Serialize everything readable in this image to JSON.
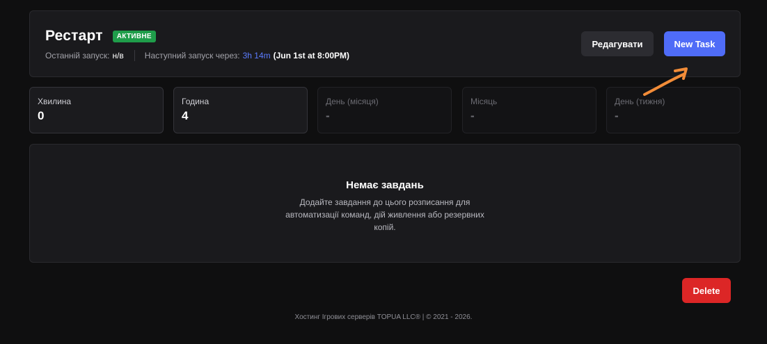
{
  "schedule": {
    "title": "Рестарт",
    "status_badge": "АКТИВНЕ",
    "last_run_label": "Останній запуск:",
    "last_run_value": "н/в",
    "next_run_label": "Наступний запуск через:",
    "next_run_in": "3h 14m",
    "next_run_at": "(Jun 1st at 8:00PM)"
  },
  "actions": {
    "edit_label": "Редагувати",
    "new_task_label": "New Task",
    "delete_label": "Delete"
  },
  "cron": [
    {
      "label": "Хвилина",
      "value": "0",
      "state": "active"
    },
    {
      "label": "Година",
      "value": "4",
      "state": "active"
    },
    {
      "label": "День (місяця)",
      "value": "-",
      "state": "muted"
    },
    {
      "label": "Місяць",
      "value": "-",
      "state": "muted"
    },
    {
      "label": "День (тижня)",
      "value": "-",
      "state": "muted"
    }
  ],
  "empty_state": {
    "title": "Немає завдань",
    "description": "Додайте завдання до цього розписання для автоматизації команд, дій живлення або резервних копій."
  },
  "footer": {
    "text": "Хостинг Ігрових серверів TOPUA LLC® | © 2021 - 2026."
  },
  "colors": {
    "accent": "#4f6cf7",
    "badge": "#1f9d4a",
    "danger": "#dc2626",
    "annotation_arrow": "#f28c38"
  },
  "icons": {
    "annotation": "arrow-annotation-icon"
  }
}
